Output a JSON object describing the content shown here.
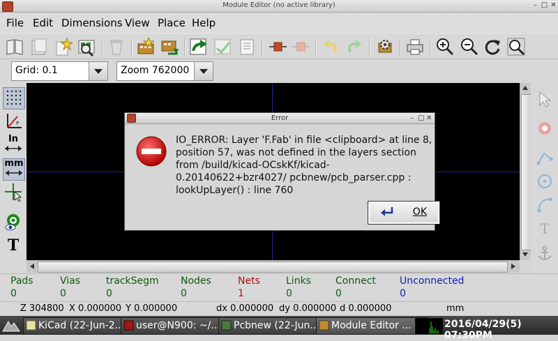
{
  "window": {
    "title": "Module Editor (no active library)"
  },
  "menu": [
    "File",
    "Edit",
    "Dimensions",
    "View",
    "Place",
    "Help"
  ],
  "combos": {
    "grid": "Grid: 0.1",
    "zoom": "Zoom 762000"
  },
  "left_toolbar": {
    "in_label": "In",
    "mm_label": "mm"
  },
  "dialog": {
    "title": "Error",
    "message": "IO_ERROR: Layer 'F.Fab' in file <clipboard> at line 8, position 57, was not defined in the layers section from /build/kicad-OCskKf/kicad-0.20140622+bzr4027/ pcbnew/pcb_parser.cpp : lookUpLayer() : line 760",
    "ok_label": "OK"
  },
  "status": [
    {
      "label": "Pads",
      "value": "0",
      "color": "#0e5a10"
    },
    {
      "label": "Vias",
      "value": "0",
      "color": "#0e5a10"
    },
    {
      "label": "trackSegm",
      "value": "0",
      "color": "#0e5a10"
    },
    {
      "label": "Nodes",
      "value": "0",
      "color": "#0e5a10"
    },
    {
      "label": "Nets",
      "value": "1",
      "color": "#b01010"
    },
    {
      "label": "Links",
      "value": "0",
      "color": "#0e5a10"
    },
    {
      "label": "Connect",
      "value": "0",
      "color": "#0e5a10"
    },
    {
      "label": "Unconnected",
      "value": "0",
      "color": "#1020b0"
    }
  ],
  "coords": {
    "z": "Z 304800",
    "x": "X 0.000000",
    "y": "Y 0.000000",
    "dx": "dx 0.000000",
    "dy": "dy 0.000000",
    "d": "d 0.000000",
    "units": "mm"
  },
  "taskbar": {
    "tasks": [
      "KiCad (22-Jun-2...",
      "user@N900: ~/...",
      "Pcbnew (22-Jun...",
      "Module Editor ..."
    ],
    "clock": "2016/04/29(5) 07:30PM"
  }
}
